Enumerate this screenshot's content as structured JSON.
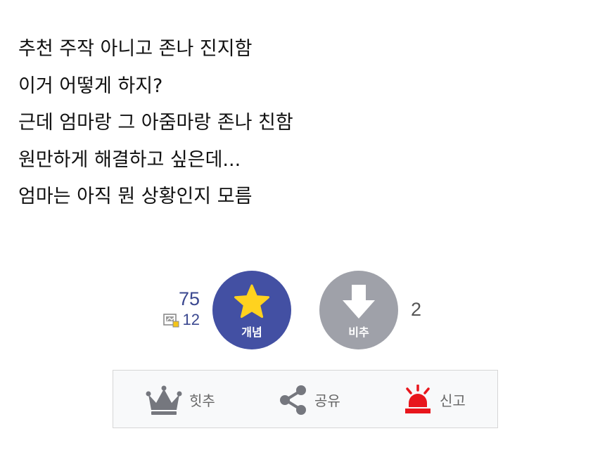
{
  "post": {
    "lines": [
      "추천 주작 아니고 존나 진지함",
      "이거 어떻게 하지?",
      "근데 엄마랑 그 아줌마랑 존나 친함",
      "원만하게 해결하고 싶은데...",
      "엄마는 아직 뭔 상황인지 모름"
    ]
  },
  "vote": {
    "up_count": "75",
    "fixed_count": "12",
    "up_label": "개념",
    "down_label": "비추",
    "down_count": "2"
  },
  "actions": {
    "hit_label": "힛추",
    "share_label": "공유",
    "report_label": "신고"
  },
  "colors": {
    "upvote_bg": "#4350a3",
    "downvote_bg": "#9fa1a9",
    "star": "#ffd21f",
    "count_blue": "#3b4890",
    "report_red": "#e8161c"
  },
  "icons": {
    "star": "star-icon",
    "down_arrow": "down-arrow-icon",
    "fixed": "fixed-user-icon",
    "crown": "crown-icon",
    "share": "share-icon",
    "siren": "siren-icon"
  }
}
